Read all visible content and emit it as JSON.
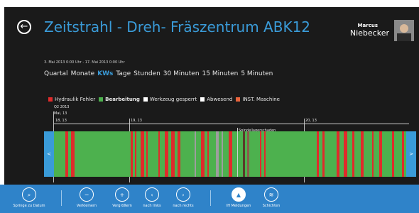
{
  "header": {
    "back_icon": "back-arrow-icon",
    "title": "Zeitstrahl - Dreh- Fräszentrum ABK12",
    "user_first": "Marcus",
    "user_last": "Niebecker"
  },
  "date_range": "3. Mai 2013 0:00 Uhr - 17. Mai 2013 0:00 Uhr",
  "scales": [
    "Quartal",
    "Monate",
    "KWs",
    "Tage",
    "Stunden",
    "30 Minuten",
    "15 Minuten",
    "5 Minuten"
  ],
  "active_scale": "KWs",
  "legend": [
    {
      "label": "Hydraulik Fehler",
      "color": "#e02b2b",
      "bold": false
    },
    {
      "label": "Bearbeitung",
      "color": "#4db14e",
      "bold": true
    },
    {
      "label": "Werkzeug gesperrt",
      "color": "#ffffff",
      "bold": false
    },
    {
      "label": "Abwesend",
      "color": "#ffffff",
      "bold": false
    },
    {
      "label": "INST. Maschine",
      "color": "#e8643c",
      "bold": false
    }
  ],
  "timeline": {
    "quarter": "Q2 2013",
    "month": "Mai, 13",
    "weeks": [
      "18, 13",
      "19, 13",
      "20, 13"
    ],
    "annotation": "Spindellagerschaden",
    "left_arrow": "<",
    "right_arrow": ">",
    "colors": {
      "running": "#4db14e",
      "error": "#e02b2b",
      "gray": "#9e9e9e",
      "brown": "#8a5a4a",
      "dark": "#5a3a2a"
    }
  },
  "appbar": [
    {
      "label": "Springe zu Datum",
      "icon": "search-icon",
      "glyph": "⌕"
    },
    {
      "label": "Verkleinern",
      "icon": "zoom-out-icon",
      "glyph": "−"
    },
    {
      "label": "Vergrößern",
      "icon": "zoom-in-icon",
      "glyph": "+"
    },
    {
      "label": "nach links",
      "icon": "chevron-left-icon",
      "glyph": "‹"
    },
    {
      "label": "nach rechts",
      "icon": "chevron-right-icon",
      "glyph": "›"
    },
    {
      "label": "IH Meldungen",
      "icon": "warning-icon",
      "glyph": "▲"
    },
    {
      "label": "Schichten",
      "icon": "layers-icon",
      "glyph": "≋"
    }
  ]
}
